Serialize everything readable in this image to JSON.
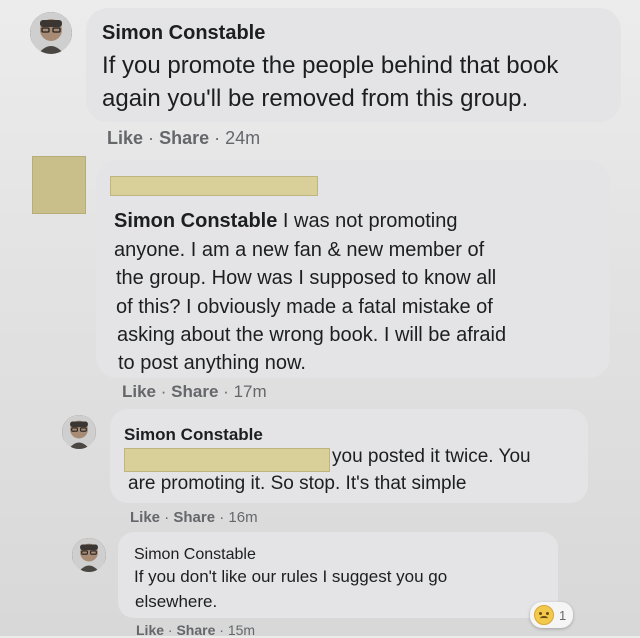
{
  "comments": [
    {
      "author": "Simon Constable",
      "lines": [
        "If you promote the people behind that book",
        "again you'll be removed from this group."
      ],
      "actions": {
        "like": "Like",
        "sep1": "·",
        "share": "Share",
        "sep2": "·",
        "time": "24m"
      }
    },
    {
      "mention": "Simon Constable",
      "lines": [
        "I was not promoting",
        "anyone. I am a new fan & new member of",
        "the group. How was I supposed to know all",
        "of this? I obviously made a fatal mistake of",
        "asking about the wrong book. I will be afraid",
        "to post anything now."
      ],
      "actions": {
        "like": "Like",
        "sep1": "·",
        "share": "Share",
        "sep2": "·",
        "time": "17m"
      }
    },
    {
      "author": "Simon Constable",
      "lines": [
        "you posted it twice. You",
        "are promoting it. So stop. It's that simple"
      ],
      "actions": {
        "like": "Like",
        "sep1": "·",
        "share": "Share",
        "sep2": "·",
        "time": "16m"
      }
    },
    {
      "author": "Simon Constable",
      "lines": [
        "If you don't like our rules I suggest you go",
        "elsewhere."
      ],
      "reaction_count": "1",
      "actions": {
        "like": "Like",
        "sep1": "·",
        "share": "Share",
        "sep2": "·",
        "time": "15m"
      }
    }
  ],
  "icons": {
    "reaction": "sad-emoji-icon"
  }
}
